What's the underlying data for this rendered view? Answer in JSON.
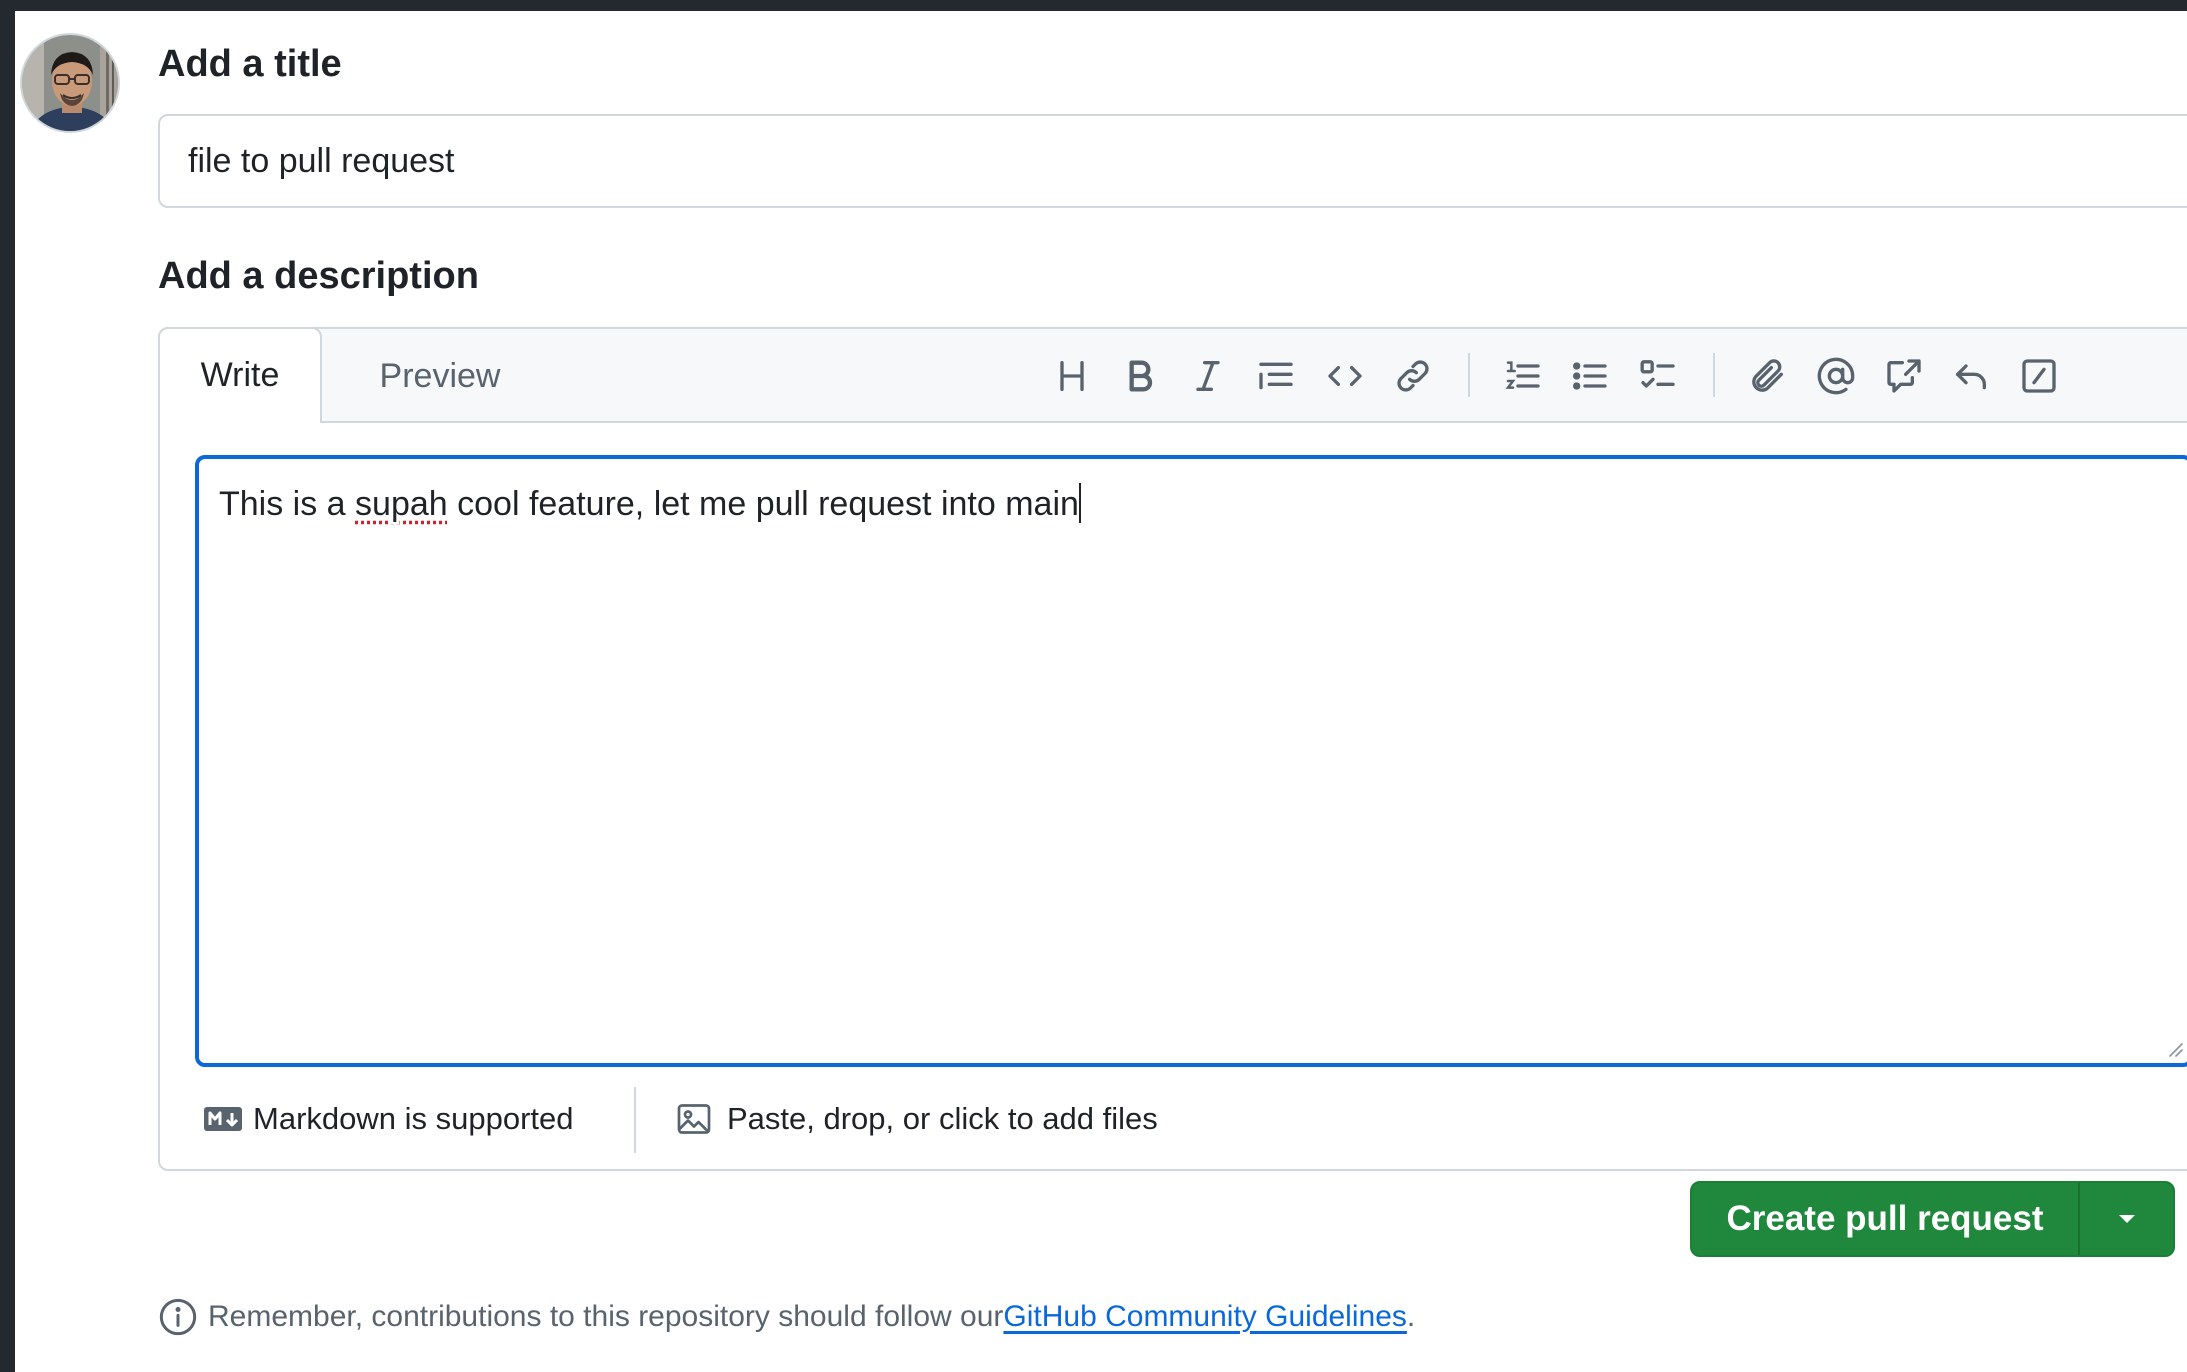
{
  "form": {
    "title_label": "Add a title",
    "title_value": "file to pull request",
    "description_label": "Add a description"
  },
  "editor": {
    "tabs": [
      {
        "label": "Write",
        "active": true
      },
      {
        "label": "Preview",
        "active": false
      }
    ],
    "toolbar": [
      "heading-icon",
      "bold-icon",
      "italic-icon",
      "quote-icon",
      "code-icon",
      "link-icon",
      "numbered-list-icon",
      "unordered-list-icon",
      "task-list-icon",
      "attach-icon",
      "mention-icon",
      "reference-icon",
      "reply-icon",
      "slash-command-icon"
    ],
    "text_before": "This is a ",
    "text_misspelled": "supah",
    "text_after": " cool feature, let me pull request into main",
    "markdown_hint": "Markdown is supported",
    "files_hint": "Paste, drop, or click to add files"
  },
  "actions": {
    "create_label": "Create pull request"
  },
  "footer": {
    "note_prefix": "Remember, contributions to this repository should follow our ",
    "link_text": "GitHub Community Guidelines",
    "note_suffix": "."
  },
  "colors": {
    "primary_green": "#1f883d",
    "focus_blue": "#0969da",
    "link_blue": "#0969da",
    "border": "#d0d7de",
    "header_bg": "#f6f8fa",
    "muted_text": "#59636e"
  }
}
